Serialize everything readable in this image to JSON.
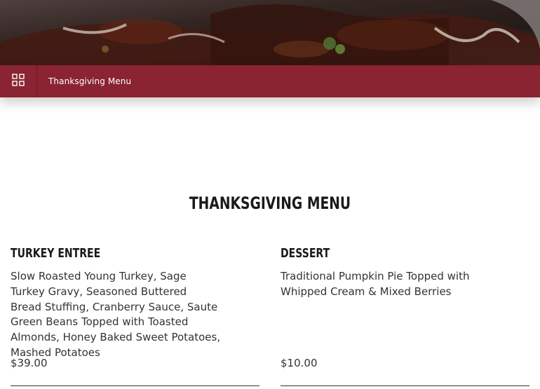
{
  "colors": {
    "nav_background": "#8a2332",
    "nav_text": "#ffffff",
    "heading_text": "#1a1a1a",
    "body_text": "#333333"
  },
  "hero": {
    "image_subject": "plated-turkey-dinner-photo"
  },
  "nav": {
    "menu_icon": "grid-icon",
    "title": "Thanksgiving Menu"
  },
  "menu": {
    "heading": "THANKSGIVING MENU",
    "items": [
      {
        "title": "TURKEY ENTREE",
        "description": "Slow Roasted Young Turkey, Sage Turkey Gravy, Seasoned Buttered Bread Stuffing, Cranberry Sauce, Saute Green Beans Topped with Toasted Almonds, Honey Baked Sweet Potatoes, Mashed Potatoes",
        "price": "$39.00"
      },
      {
        "title": "DESSERT",
        "description": "Traditional Pumpkin Pie Topped with Whipped Cream & Mixed Berries",
        "price": "$10.00"
      }
    ]
  }
}
